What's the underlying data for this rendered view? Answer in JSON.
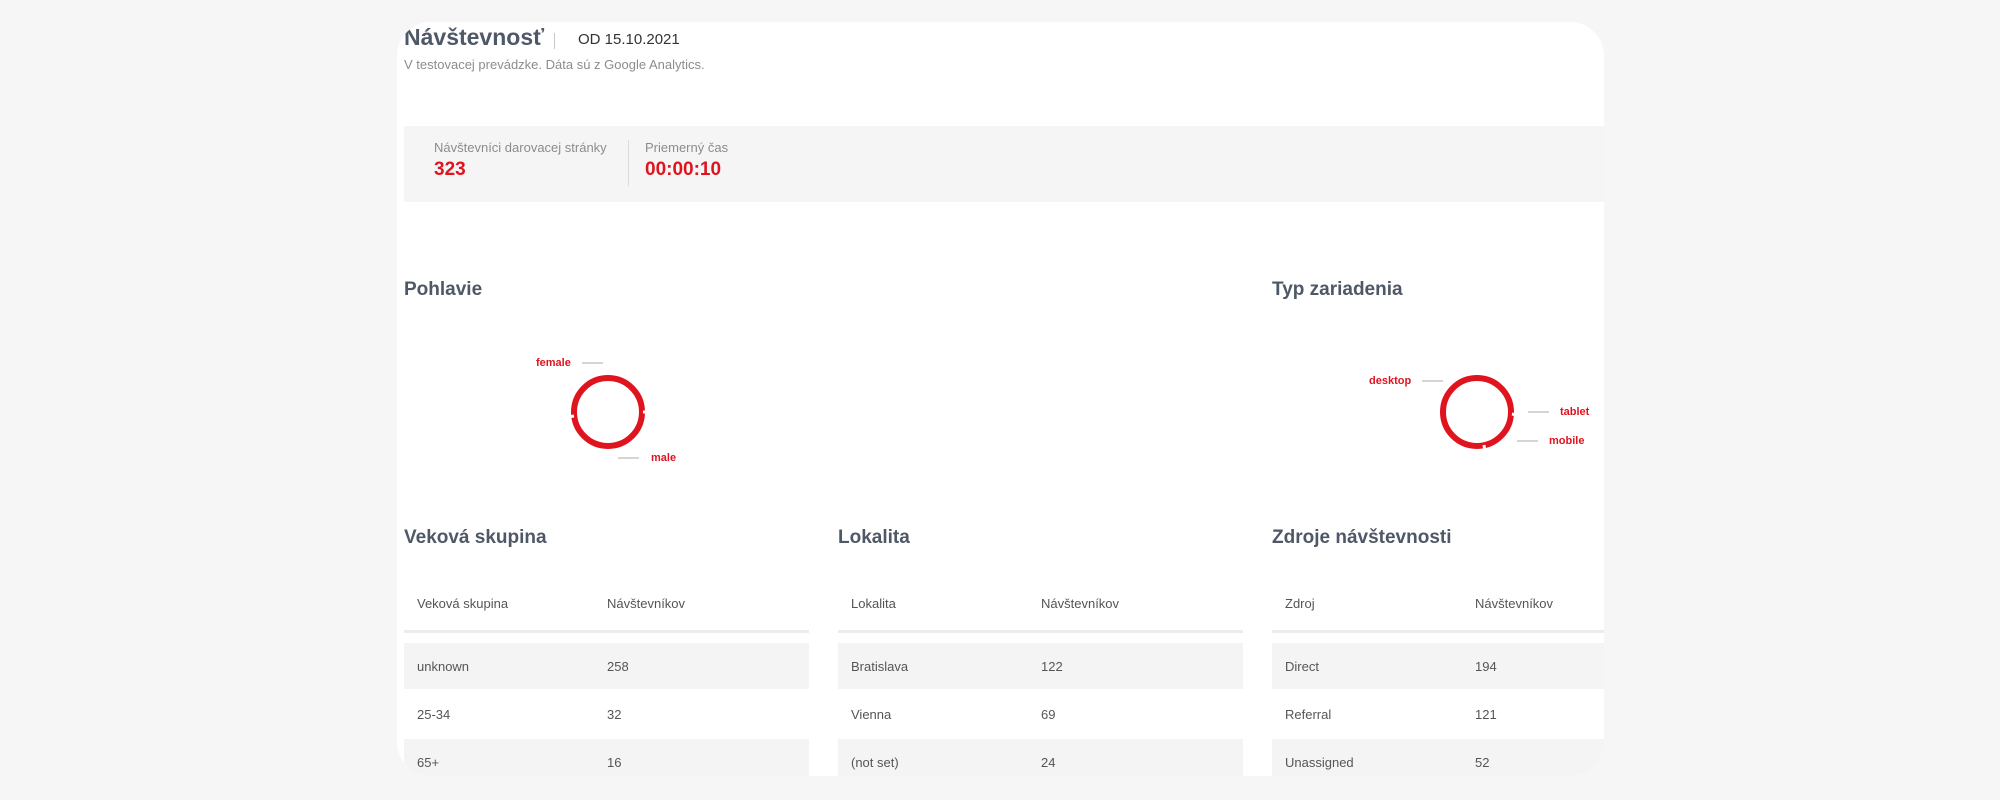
{
  "header": {
    "title": "Návštevnosť",
    "date": "OD 15.10.2021",
    "subtitle": "V testovacej prevádzke. Dáta sú z Google Analytics."
  },
  "stats": [
    {
      "label": "Návštevníci darovacej stránky",
      "value": "323"
    },
    {
      "label": "Priemerný čas",
      "value": "00:00:10"
    }
  ],
  "gender": {
    "title": "Pohlavie",
    "labels": [
      "female",
      "male"
    ]
  },
  "device": {
    "title": "Typ zariadenia",
    "labels": [
      "desktop",
      "tablet",
      "mobile"
    ]
  },
  "age": {
    "title": "Veková skupina",
    "columns": [
      "Veková skupina",
      "Návštevníkov"
    ],
    "rows": [
      [
        "unknown",
        "258"
      ],
      [
        "25-34",
        "32"
      ],
      [
        "65+",
        "16"
      ]
    ]
  },
  "location": {
    "title": "Lokalita",
    "columns": [
      "Lokalita",
      "Návštevníkov"
    ],
    "rows": [
      [
        "Bratislava",
        "122"
      ],
      [
        "Vienna",
        "69"
      ],
      [
        "(not set)",
        "24"
      ]
    ]
  },
  "sources": {
    "title": "Zdroje návštevnosti",
    "columns": [
      "Zdroj",
      "Návštevníkov"
    ],
    "rows": [
      [
        "Direct",
        "194"
      ],
      [
        "Referral",
        "121"
      ],
      [
        "Unassigned",
        "52"
      ]
    ]
  },
  "colors": {
    "accent": "#e0141e",
    "heading": "#4e5866",
    "muted": "#8c8c8c"
  }
}
